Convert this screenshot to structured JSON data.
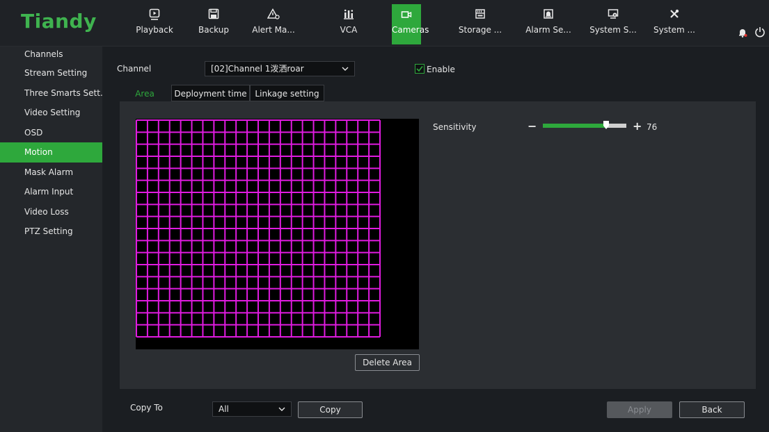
{
  "brand": {
    "logo_text": "Tiandy",
    "accent": "#2ea83c",
    "logo_color": "#3fb34f"
  },
  "nav": [
    {
      "label": "Playback",
      "icon": "playback-icon"
    },
    {
      "label": "Backup",
      "icon": "save-icon"
    },
    {
      "label": "Alert Ma...",
      "icon": "alert-icon"
    },
    {
      "label": "VCA",
      "icon": "vca-chart-icon"
    },
    {
      "label": "Cameras",
      "icon": "camera-icon",
      "active": true
    },
    {
      "label": "Storage ...",
      "icon": "storage-icon"
    },
    {
      "label": "Alarm Se...",
      "icon": "alarm-settings-icon"
    },
    {
      "label": "System S...",
      "icon": "system-settings-icon"
    },
    {
      "label": "System ...",
      "icon": "tools-icon"
    }
  ],
  "header_icons": [
    "bell-icon",
    "power-icon"
  ],
  "sidebar": {
    "items": [
      {
        "label": "Channels"
      },
      {
        "label": "Stream Setting"
      },
      {
        "label": "Three Smarts Sett..."
      },
      {
        "label": "Video Setting"
      },
      {
        "label": "OSD"
      },
      {
        "label": "Motion",
        "active": true
      },
      {
        "label": "Mask Alarm"
      },
      {
        "label": "Alarm Input"
      },
      {
        "label": "Video Loss"
      },
      {
        "label": "PTZ Setting"
      }
    ]
  },
  "main": {
    "channel_label": "Channel",
    "channel_value": "[02]Channel 1泼洒roar",
    "enable_label": "Enable",
    "enable_checked": true,
    "tabs": [
      {
        "label": "Area Setting",
        "active": true
      },
      {
        "label": "Deployment time"
      },
      {
        "label": "Linkage setting"
      }
    ],
    "sensitivity_label": "Sensitivity",
    "sensitivity_minus": "−",
    "sensitivity_plus": "+",
    "sensitivity_value": "76",
    "sensitivity_fraction": 0.76,
    "delete_area_label": "Delete Area",
    "grid_color": "#e01be0",
    "copy_to_label": "Copy To",
    "copy_to_value": "All",
    "copy_label": "Copy",
    "apply_label": "Apply",
    "back_label": "Back"
  }
}
